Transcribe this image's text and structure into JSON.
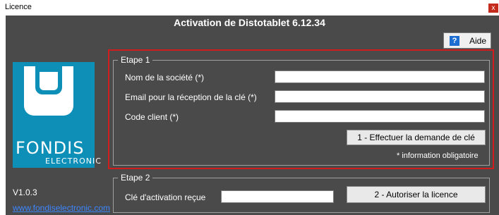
{
  "window": {
    "title": "Licence",
    "close_glyph": "x"
  },
  "header": {
    "heading": "Activation de Distotablet 6.12.34",
    "help_label": "Aide",
    "help_icon": "?"
  },
  "brand": {
    "name": "FONDIS",
    "subtitle": "ELECTRONIC",
    "version": "V1.0.3",
    "website": "www.fondiselectronic.com",
    "accent": "#0d8fb8"
  },
  "step1": {
    "title": "Etape 1",
    "company_label": "Nom de la société (*)",
    "company_value": "",
    "email_label": "Email pour la réception de la clé (*)",
    "email_value": "",
    "client_label": "Code client (*)",
    "client_value": "",
    "request_button": "1 - Effectuer la demande de clé",
    "required_note": "* information obligatoire",
    "highlight_color": "#cf1c1c"
  },
  "step2": {
    "title": "Etape 2",
    "key_label": "Clé d'activation reçue",
    "key_value": "",
    "authorize_button": "2 - Autoriser la licence"
  }
}
